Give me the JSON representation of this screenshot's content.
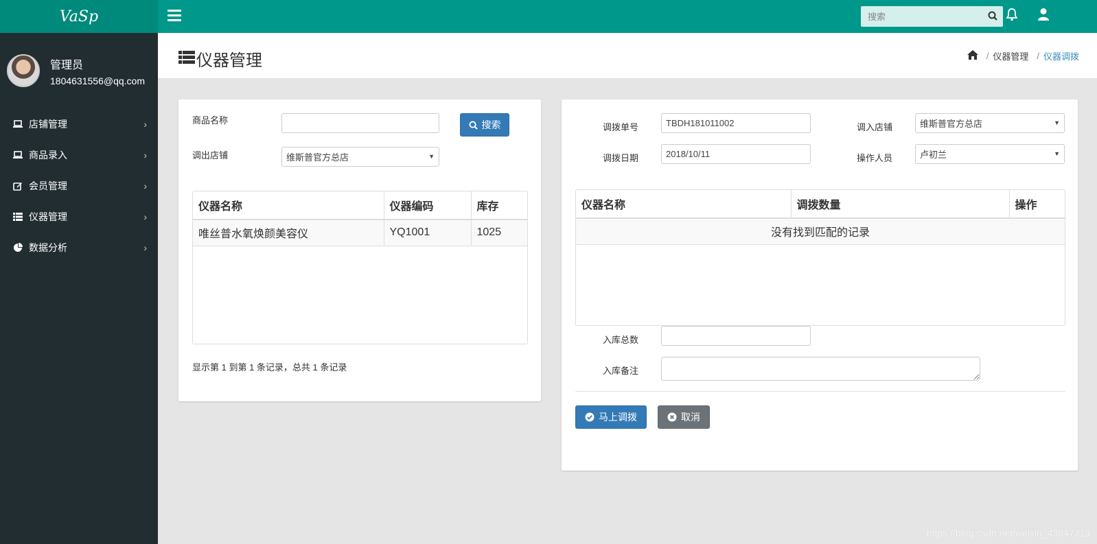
{
  "app": {
    "logo_text": "VaSp"
  },
  "user": {
    "name": "管理员",
    "email": "1804631556@qq.com"
  },
  "sidebar": {
    "items": [
      {
        "label": "店铺管理",
        "icon": "laptop-icon"
      },
      {
        "label": "商品录入",
        "icon": "laptop-icon"
      },
      {
        "label": "会员管理",
        "icon": "edit-icon"
      },
      {
        "label": "仪器管理",
        "icon": "list-icon"
      },
      {
        "label": "数据分析",
        "icon": "pie-chart-icon"
      }
    ]
  },
  "topbar": {
    "search_placeholder": "搜索"
  },
  "header": {
    "title": "仪器管理",
    "breadcrumb": {
      "level1": "仪器管理",
      "level2": "仪器调拨"
    }
  },
  "left_panel": {
    "product_name_label": "商品名称",
    "product_name_value": "",
    "search_button": "搜索",
    "out_store_label": "调出店铺",
    "out_store_value": "维斯普官方总店",
    "table": {
      "columns": [
        "仪器名称",
        "仪器编码",
        "库存"
      ],
      "rows": [
        {
          "name": "唯丝普水氧焕颜美容仪",
          "code": "YQ1001",
          "stock": "1025"
        }
      ]
    },
    "pagination_text": "显示第 1 到第 1 条记录，总共 1 条记录"
  },
  "right_panel": {
    "transfer_no_label": "调拨单号",
    "transfer_no_value": "TBDH181011002",
    "in_store_label": "调入店铺",
    "in_store_value": "维斯普官方总店",
    "transfer_date_label": "调拨日期",
    "transfer_date_value": "2018/10/11",
    "operator_label": "操作人员",
    "operator_value": "卢初兰",
    "table": {
      "columns": [
        "仪器名称",
        "调拨数量",
        "操作"
      ],
      "empty_text": "没有找到匹配的记录"
    },
    "total_label": "入库总数",
    "total_value": "",
    "note_label": "入库备注",
    "note_value": "",
    "confirm_button": "马上调拨",
    "cancel_button": "取消"
  },
  "watermark": "https://blog.csdn.net/weixin_43847313",
  "colors": {
    "topbar": "#00988a",
    "logo_bg": "#008a7c",
    "sidebar": "#222d32",
    "primary": "#337ab7",
    "link": "#3c8dbc"
  }
}
